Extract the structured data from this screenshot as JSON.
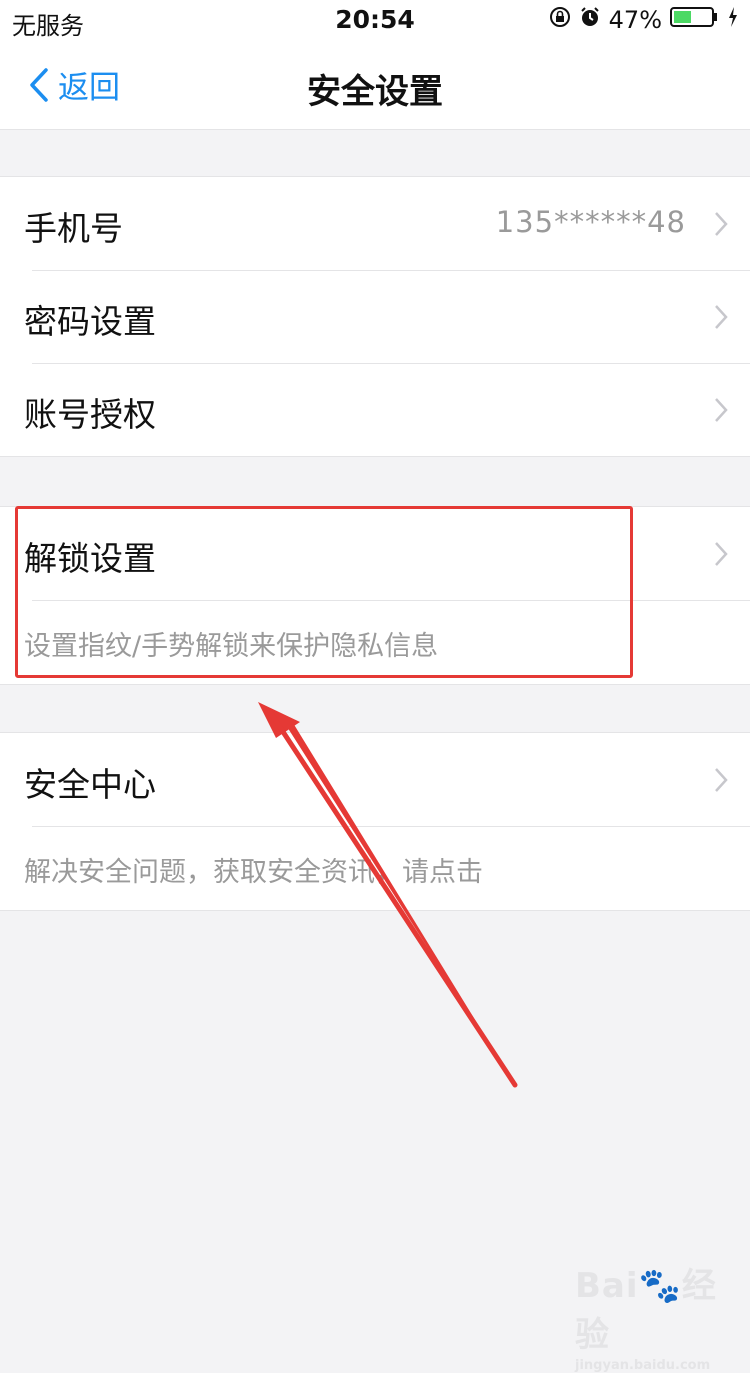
{
  "status_bar": {
    "carrier": "无服务",
    "time": "20:54",
    "battery_percent": "47%",
    "battery_level": 0.47,
    "icons": [
      "orientation-lock-icon",
      "alarm-icon",
      "battery-icon",
      "charging-icon"
    ]
  },
  "nav": {
    "back_label": "返回",
    "title": "安全设置"
  },
  "groups": {
    "account": {
      "phone": {
        "label": "手机号",
        "value": "135******48"
      },
      "password": {
        "label": "密码设置"
      },
      "auth": {
        "label": "账号授权"
      }
    },
    "unlock": {
      "label": "解锁设置",
      "hint": "设置指纹/手势解锁来保护隐私信息"
    },
    "security_center": {
      "label": "安全中心",
      "hint": "解决安全问题，获取安全资讯，请点击"
    }
  },
  "watermark": {
    "main": "Bai\u0000经验",
    "sub": "jingyan.baidu.com"
  },
  "colors": {
    "accent": "#1c8ef0",
    "highlight": "#e53935",
    "battery": "#4cd964"
  }
}
